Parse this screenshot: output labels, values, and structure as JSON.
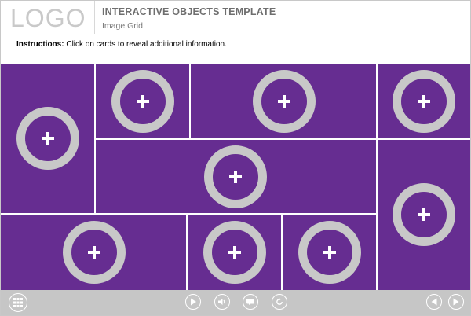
{
  "header": {
    "logo": "LOGO",
    "title": "INTERACTIVE OBJECTS TEMPLATE",
    "subtitle": "Image Grid",
    "instructions_label": "Instructions:",
    "instructions_text": " Click on cards to reveal additional information."
  },
  "cards": [
    {
      "id": 1,
      "icon": "plus-icon"
    },
    {
      "id": 2,
      "icon": "plus-icon"
    },
    {
      "id": 3,
      "icon": "plus-icon"
    },
    {
      "id": 4,
      "icon": "plus-icon"
    },
    {
      "id": 5,
      "icon": "plus-icon"
    },
    {
      "id": 6,
      "icon": "plus-icon"
    },
    {
      "id": 7,
      "icon": "plus-icon"
    },
    {
      "id": 8,
      "icon": "plus-icon"
    },
    {
      "id": 9,
      "icon": "plus-icon"
    }
  ],
  "toolbar": {
    "menu_icon": "grid-menu-icon",
    "play_icon": "play-icon",
    "audio_icon": "volume-icon",
    "captions_icon": "captions-icon",
    "replay_icon": "replay-icon",
    "prev_icon": "previous-icon",
    "next_icon": "next-icon"
  },
  "colors": {
    "card": "#662d91",
    "ring": "#c8c8c8",
    "bar": "#c6c6c6",
    "logo": "#c9c9c9"
  }
}
